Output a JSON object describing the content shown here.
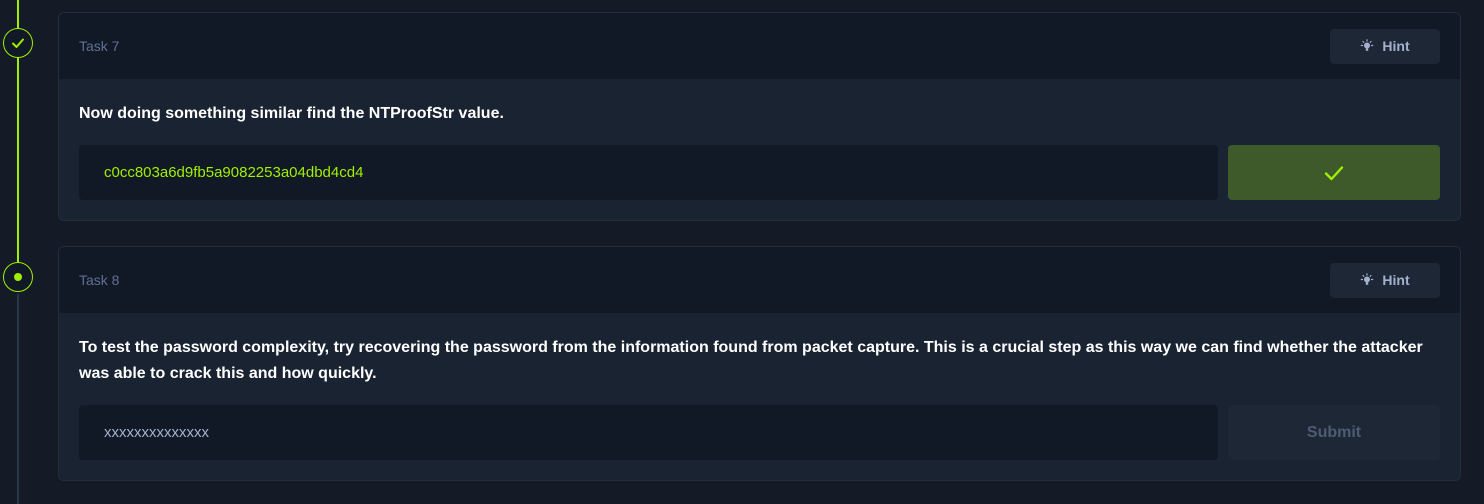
{
  "colors": {
    "accent": "#9fef00",
    "card_bg": "#1a2332",
    "card_header_bg": "#111927",
    "correct_button_bg": "#3f5a2a"
  },
  "tasks": [
    {
      "label": "Task 7",
      "status": "completed",
      "hint_label": "Hint",
      "question": "Now doing something similar find the NTProofStr value.",
      "answer_value": "c0cc803a6d9fb5a9082253a04dbd4cd4",
      "button_icon": "checkmark-icon"
    },
    {
      "label": "Task 8",
      "status": "current",
      "hint_label": "Hint",
      "question": "To test the password complexity, try recovering the password from the information found from packet capture. This is a crucial step as this way we can find whether the attacker was able to crack this and how quickly.",
      "answer_placeholder": "xxxxxxxxxxxxxx",
      "submit_label": "Submit"
    }
  ]
}
